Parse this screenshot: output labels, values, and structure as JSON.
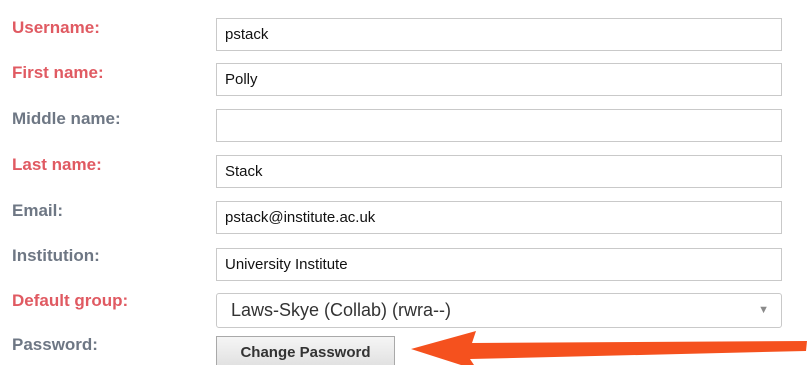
{
  "form": {
    "username": {
      "label": "Username:",
      "value": "pstack",
      "required": true
    },
    "first_name": {
      "label": "First name:",
      "value": "Polly",
      "required": true
    },
    "middle_name": {
      "label": "Middle name:",
      "value": "",
      "required": false
    },
    "last_name": {
      "label": "Last name:",
      "value": "Stack",
      "required": true
    },
    "email": {
      "label": "Email:",
      "value": "pstack@institute.ac.uk",
      "required": false
    },
    "institution": {
      "label": "Institution:",
      "value": "University Institute",
      "required": false
    },
    "default_group": {
      "label": "Default group:",
      "selected": "Laws-Skye (Collab) (rwra--)",
      "required": true
    },
    "password": {
      "label": "Password:",
      "button_label": "Change Password",
      "required": false
    }
  },
  "colors": {
    "required_label": "#e05a62",
    "optional_label": "#6e7784",
    "annotation_arrow": "#f5511e"
  },
  "icons": {
    "select_chevron": "chevron-down-icon",
    "annotation": "arrow-annotation"
  }
}
